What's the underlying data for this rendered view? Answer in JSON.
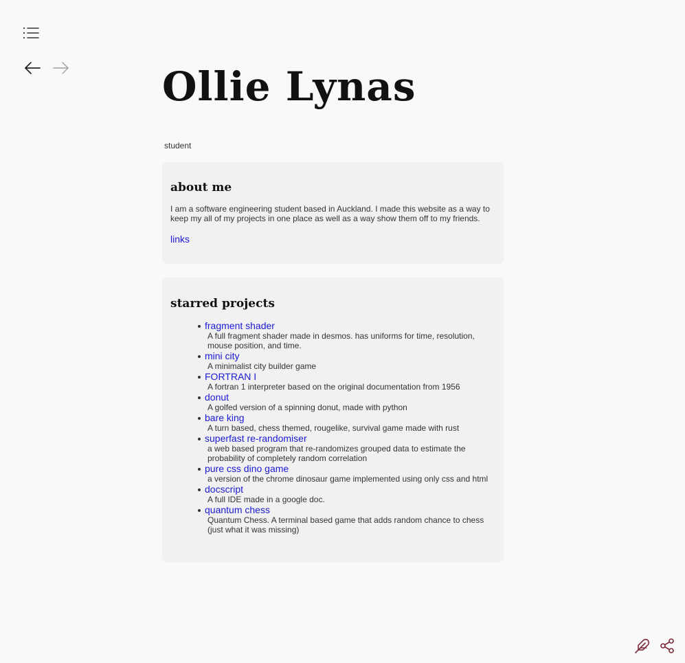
{
  "header": {
    "title": "Ollie Lynas",
    "subtitle": "student"
  },
  "toolbar": {
    "toc_icon": "list-icon",
    "back_icon": "arrow-left-icon",
    "forward_icon": "arrow-right-icon"
  },
  "about": {
    "heading": "about me",
    "text": "I am a software engineering student based in Auckland. I made this website as a way to keep my all of my projects in one place as well as a way show them off to my friends.",
    "link_label": "links"
  },
  "starred": {
    "heading": "starred projects",
    "projects": [
      {
        "title": "fragment shader",
        "description": "A full fragment shader made in desmos. has uniforms for time, resolution, mouse position, and time."
      },
      {
        "title": "mini city",
        "description": "A minimalist city builder game"
      },
      {
        "title": "FORTRAN I",
        "description": "A fortran 1 interpreter based on the original documentation from 1956"
      },
      {
        "title": "donut",
        "description": "A golfed version of a spinning donut, made with python"
      },
      {
        "title": "bare king",
        "description": "A turn based, chess themed, rougelike, survival game made with rust"
      },
      {
        "title": "superfast re-randomiser",
        "description": "a web based program that re-randomizes grouped data to estimate the probability of completely random correlation"
      },
      {
        "title": "pure css dino game",
        "description": "a version of the chrome dinosaur game implemented using only css and html"
      },
      {
        "title": "docscript",
        "description": "A full IDE made in a google doc."
      },
      {
        "title": "quantum chess",
        "description": "Quantum Chess. A terminal based game that adds random chance to chess (just what it was missing)"
      }
    ]
  },
  "footer": {
    "edit_icon": "feather-icon",
    "share_icon": "share-icon"
  },
  "colors": {
    "link": "#1a1ad6",
    "card_bg": "#f1f1f1",
    "page_bg": "#f9f9f9",
    "icon_accent": "#7a2a3a"
  }
}
